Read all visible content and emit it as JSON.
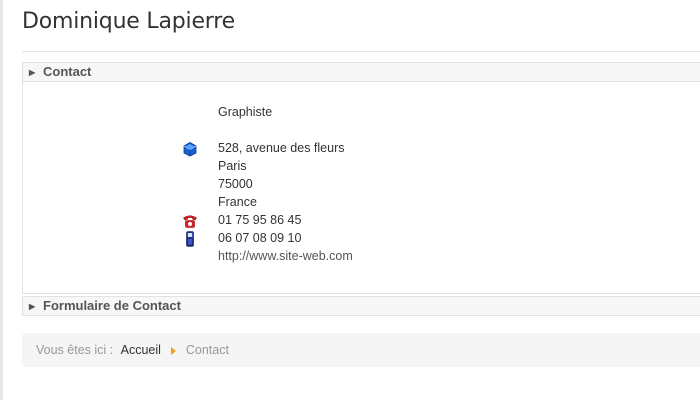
{
  "page": {
    "title": "Dominique Lapierre"
  },
  "contact_panel": {
    "header": "Contact",
    "position": "Graphiste",
    "address": {
      "street": "528, avenue des fleurs",
      "city": "Paris",
      "postcode": "75000",
      "country": "France"
    },
    "phone": "01 75 95 86 45",
    "mobile": "06 07 08 09 10",
    "website": "http://www.site-web.com"
  },
  "form_panel": {
    "header": "Formulaire de Contact"
  },
  "breadcrumb": {
    "prefix": "Vous êtes ici :",
    "home": "Accueil",
    "current": "Contact"
  },
  "icons": {
    "address": "address-icon",
    "phone": "telephone-icon",
    "mobile": "mobile-phone-icon",
    "breadcrumb_separator": "caret-right-icon"
  },
  "colors": {
    "separator_caret": "#f0a020"
  }
}
